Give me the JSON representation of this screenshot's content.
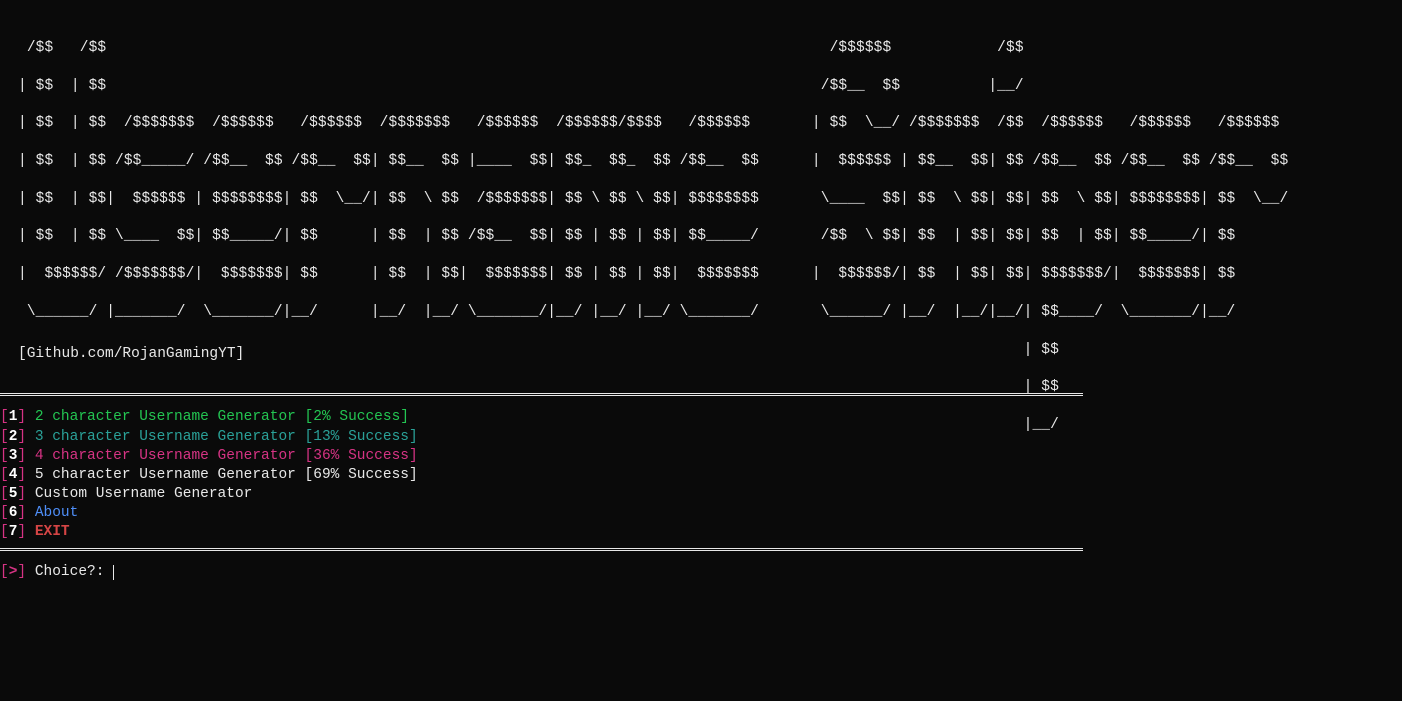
{
  "ascii_banner": " /$$   /$$                                                                                  /$$$$$$            /$$                                        \n| $$  | $$                                                                                 /$$__  $$          |__/                                        \n| $$  | $$  /$$$$$$$  /$$$$$$   /$$$$$$  /$$$$$$$   /$$$$$$  /$$$$$$/$$$$   /$$$$$$       | $$  \\__/ /$$$$$$$  /$$  /$$$$$$   /$$$$$$   /$$$$$$            \n| $$  | $$ /$$_____/ /$$__  $$ /$$__  $$| $$__  $$ |____  $$| $$_  $$_  $$ /$$__  $$      |  $$$$$$ | $$__  $$| $$ /$$__  $$ /$$__  $$ /$$__  $$           \n| $$  | $$|  $$$$$$ | $$$$$$$$| $$  \\__/| $$  \\ $$  /$$$$$$$| $$ \\ $$ \\ $$| $$$$$$$$       \\____  $$| $$  \\ $$| $$| $$  \\ $$| $$$$$$$$| $$  \\__/           \n| $$  | $$ \\____  $$| $$_____/| $$      | $$  | $$ /$$__  $$| $$ | $$ | $$| $$_____/       /$$  \\ $$| $$  | $$| $$| $$  | $$| $$_____/| $$                 \n|  $$$$$$/ /$$$$$$$/|  $$$$$$$| $$      | $$  | $$|  $$$$$$$| $$ | $$ | $$|  $$$$$$$      |  $$$$$$/| $$  | $$| $$| $$$$$$$/|  $$$$$$$| $$                 \n \\______/ |_______/  \\_______/|__/      |__/  |__/ \\_______/|__/ |__/ |__/ \\_______/       \\______/ |__/  |__/|__/| $$____/  \\_______/|__/                 \n                                                                                                                  | $$                                     \n                                                                                                                  | $$                                     \n                                                                                                                  |__/                                     ",
  "credit": "[Github.com/RojanGamingYT]",
  "menu": {
    "items": [
      {
        "idx": "1",
        "label": "2 character Username Generator [2% Success]",
        "color": "green"
      },
      {
        "idx": "2",
        "label": "3 character Username Generator [13% Success]",
        "color": "teal"
      },
      {
        "idx": "3",
        "label": "4 character Username Generator [36% Success]",
        "color": "pink"
      },
      {
        "idx": "4",
        "label": "5 character Username Generator [69% Success]",
        "color": "white"
      },
      {
        "idx": "5",
        "label": "Custom Username Generator",
        "color": "white"
      },
      {
        "idx": "6",
        "label": "About",
        "color": "blue"
      },
      {
        "idx": "7",
        "label": "EXIT",
        "color": "red"
      }
    ]
  },
  "prompt": {
    "symbol": ">",
    "label": "Choice?:",
    "value": ""
  },
  "brackets": {
    "open": "[",
    "close": "]"
  }
}
